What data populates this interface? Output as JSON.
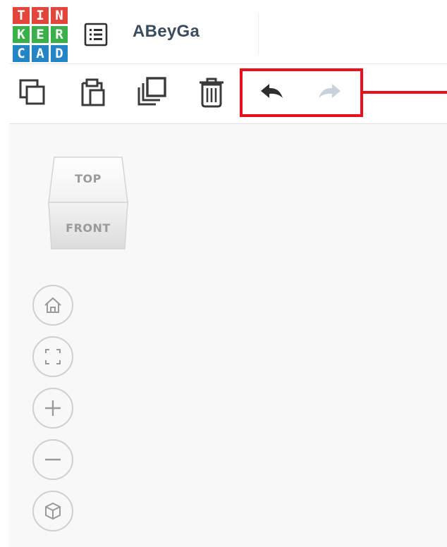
{
  "app": {
    "logo_letters": [
      "T",
      "I",
      "N",
      "K",
      "E",
      "R",
      "C",
      "A",
      "D"
    ],
    "logo_colors": [
      "#e2453c",
      "#e2453c",
      "#e2453c",
      "#3ab04a",
      "#3ab04a",
      "#3ab04a",
      "#2384c6",
      "#2384c6",
      "#2384c6"
    ],
    "design_title": "ABeyGa"
  },
  "toolbar": {
    "buttons": [
      {
        "name": "copy",
        "icon": "copy-icon",
        "enabled": true
      },
      {
        "name": "paste",
        "icon": "paste-icon",
        "enabled": true
      },
      {
        "name": "duplicate",
        "icon": "duplicate-icon",
        "enabled": true
      },
      {
        "name": "delete",
        "icon": "trash-icon",
        "enabled": true
      },
      {
        "name": "undo",
        "icon": "undo-arrow-icon",
        "enabled": true
      },
      {
        "name": "redo",
        "icon": "redo-arrow-icon",
        "enabled": false
      }
    ],
    "highlight_color": "#e8101c"
  },
  "view_cube": {
    "top_label": "TOP",
    "front_label": "FRONT"
  },
  "nav_controls": [
    {
      "name": "home-view",
      "icon": "home-icon"
    },
    {
      "name": "fit-view",
      "icon": "fit-all-icon"
    },
    {
      "name": "zoom-in",
      "icon": "plus-icon"
    },
    {
      "name": "zoom-out",
      "icon": "minus-icon"
    },
    {
      "name": "projection",
      "icon": "perspective-cube-icon"
    }
  ],
  "colors": {
    "title_text": "#3c4c5f",
    "icon_dark": "#3a3a3a",
    "icon_disabled": "#c8d2da",
    "workplane_bg": "#f8f8f8"
  }
}
